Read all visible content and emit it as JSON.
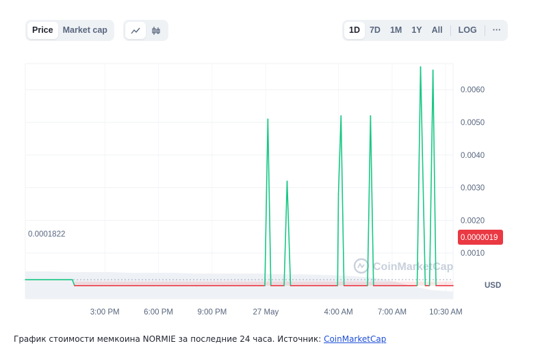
{
  "tabs": {
    "metric": [
      {
        "label": "Price",
        "active": true
      },
      {
        "label": "Market cap",
        "active": false
      }
    ],
    "chart_type": [
      {
        "icon": "line-chart-icon",
        "active": true
      },
      {
        "icon": "candlestick-icon",
        "active": false
      }
    ],
    "ranges": [
      {
        "label": "1D",
        "active": true
      },
      {
        "label": "7D",
        "active": false
      },
      {
        "label": "1M",
        "active": false
      },
      {
        "label": "1Y",
        "active": false
      },
      {
        "label": "All",
        "active": false
      }
    ],
    "scale_label": "LOG",
    "more_label": "···"
  },
  "chart_data": {
    "type": "line",
    "ylim": [
      -0.0004,
      0.0068
    ],
    "y_ticks": [
      0.001,
      0.002,
      0.003,
      0.004,
      0.005,
      0.006
    ],
    "y_tick_labels": [
      "0.0010",
      "0.0020",
      "0.0030",
      "0.0040",
      "0.0050",
      "0.0060"
    ],
    "x_ticks": [
      {
        "pos": 0.1859,
        "label": "3:00 PM"
      },
      {
        "pos": 0.3113,
        "label": "6:00 PM"
      },
      {
        "pos": 0.4367,
        "label": "9:00 PM"
      },
      {
        "pos": 0.5622,
        "label": "27 May"
      },
      {
        "pos": 0.7322,
        "label": "4:00 AM"
      },
      {
        "pos": 0.8576,
        "label": "7:00 AM"
      },
      {
        "pos": 0.983,
        "label": "10:30 AM"
      }
    ],
    "series": [
      {
        "x": [
          0,
          0.11,
          0.115,
          0.125,
          0.2,
          0.3,
          0.4,
          0.5,
          0.55,
          0.56,
          0.567,
          0.574,
          0.605,
          0.612,
          0.62,
          0.72,
          0.73,
          0.732,
          0.738,
          0.745,
          0.8,
          0.807,
          0.814,
          0.9,
          0.916,
          0.924,
          0.935,
          0.945,
          0.953,
          0.96,
          0.975,
          1.0
        ],
        "y": [
          0.0001822,
          0.0001822,
          1.9e-06,
          1.9e-06,
          1.9e-06,
          1.9e-06,
          1.9e-06,
          1.9e-06,
          1.9e-06,
          1.9e-06,
          0.0051,
          1.9e-06,
          1.9e-06,
          0.0032,
          1.9e-06,
          1.9e-06,
          1.9e-06,
          0.0028,
          0.0052,
          1.9e-06,
          1.9e-06,
          0.0052,
          1.9e-06,
          1.9e-06,
          1.9e-06,
          0.0067,
          1.9e-06,
          1.9e-06,
          0.0066,
          1.9e-06,
          1.9e-06,
          1.9e-06
        ]
      }
    ],
    "baseline_label": "0.0001822",
    "current_label": "0.0000019",
    "currency_label": "USD",
    "colors": {
      "up": "#16c784",
      "down": "#ea3943",
      "label_bg": "#ea3943"
    },
    "volume": [
      0.38,
      0.38,
      0.37,
      0.37,
      0.37,
      0.36,
      0.36,
      0.36,
      0.35,
      0.35,
      0.35,
      0.35,
      0.34,
      0.34,
      0.33,
      0.32,
      0.3,
      0.26,
      0.18,
      0.12,
      0.1
    ],
    "watermark": "CoinMarketCap",
    "grid": true
  },
  "caption": {
    "text": "График стоимости мемкоина NORMIE за последние 24 часа. Источник: ",
    "link": "CoinMarketCap"
  }
}
